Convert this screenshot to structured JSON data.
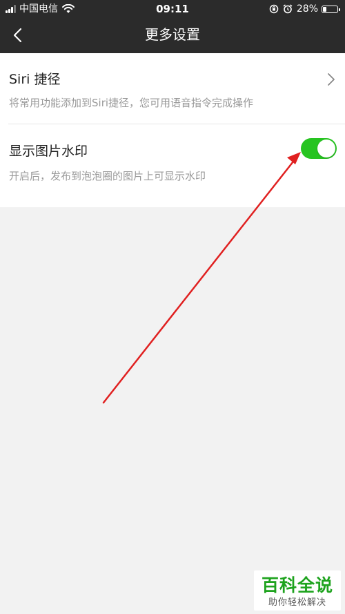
{
  "status_bar": {
    "carrier": "中国电信",
    "time": "09:11",
    "battery_percent": "28%",
    "battery_level": 0.28,
    "icons": [
      "signal-icon",
      "wifi-icon",
      "rotation-lock-icon",
      "alarm-icon",
      "battery-icon"
    ]
  },
  "nav": {
    "title": "更多设置",
    "back_icon": "chevron-left-icon"
  },
  "settings": {
    "siri": {
      "title": "Siri 捷径",
      "description": "将常用功能添加到Siri捷径，您可用语音指令完成操作",
      "icon": "chevron-right-icon"
    },
    "watermark": {
      "title": "显示图片水印",
      "description": "开启后，发布到泡泡圈的图片上可显示水印",
      "toggle_on": true
    }
  },
  "logo": {
    "main": "百科全说",
    "sub": "助你轻松解决"
  },
  "colors": {
    "header_bg": "#2b2b2b",
    "toggle_on": "#27c421",
    "arrow": "#e02020",
    "page_bg": "#f2f2f2",
    "logo_green": "#1ea31e"
  }
}
